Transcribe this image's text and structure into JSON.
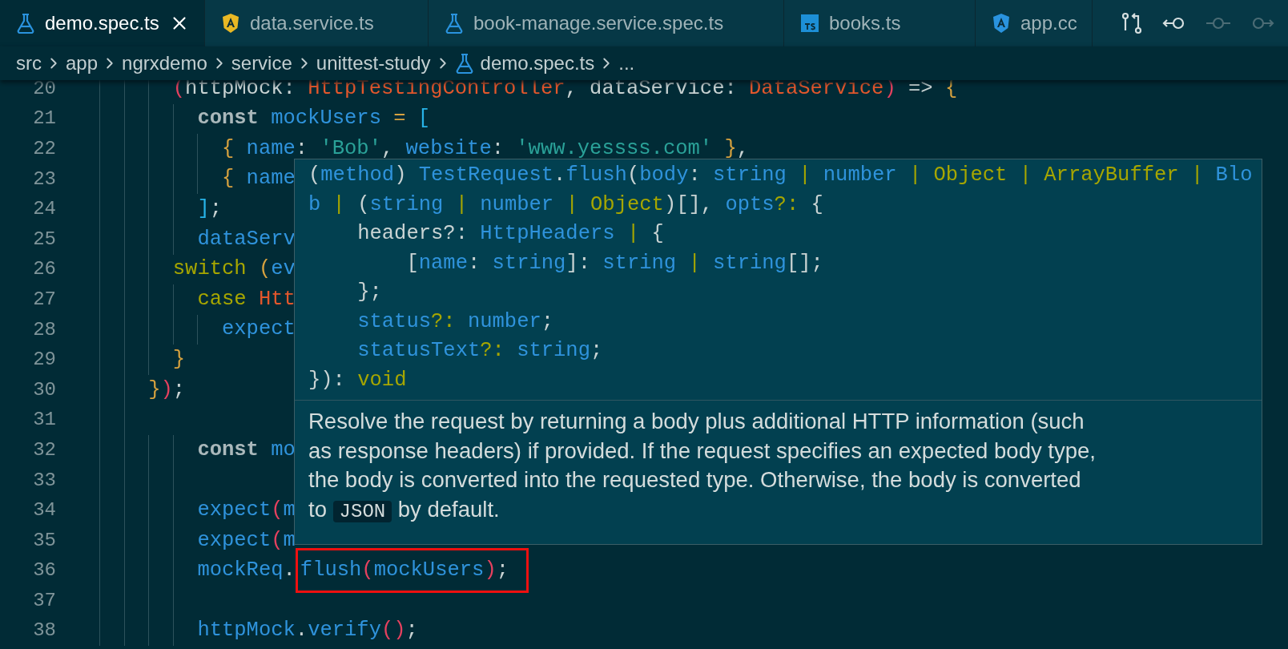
{
  "tabs": [
    {
      "label": "demo.spec.ts",
      "kind": "test",
      "selected": true
    },
    {
      "label": "data.service.ts",
      "kind": "service",
      "selected": false
    },
    {
      "label": "book-manage.service.spec.ts",
      "kind": "test",
      "selected": false
    },
    {
      "label": "books.ts",
      "kind": "typescript",
      "selected": false
    },
    {
      "label": "app.cc",
      "kind": "component",
      "selected": false
    }
  ],
  "toolbar": [
    {
      "kind": "compare",
      "disabled": false
    },
    {
      "kind": "back",
      "disabled": false
    },
    {
      "kind": "commit",
      "disabled": true
    },
    {
      "kind": "forward",
      "disabled": true
    }
  ],
  "breadcrumb": [
    {
      "label": "src",
      "kind": "folder"
    },
    {
      "label": "app",
      "kind": "folder"
    },
    {
      "label": "ngrxdemo",
      "kind": "folder"
    },
    {
      "label": "service",
      "kind": "folder"
    },
    {
      "label": "unittest-study",
      "kind": "folder"
    },
    {
      "label": "demo.spec.ts",
      "kind": "file"
    },
    {
      "label": "...",
      "kind": "folder"
    }
  ],
  "code": [
    {
      "number": "20",
      "tokens": [
        {
          "t": "      (",
          "kind": "pink"
        },
        {
          "t": "httpMock: ",
          "kind": "plain"
        },
        {
          "t": "HttpTestingController",
          "kind": "type"
        },
        {
          "t": ", dataService: ",
          "kind": "plain"
        },
        {
          "t": "DataService",
          "kind": "type"
        },
        {
          "t": ")",
          "kind": "pink"
        },
        {
          "t": " => ",
          "kind": "plain"
        },
        {
          "t": "{",
          "kind": "gold"
        }
      ]
    },
    {
      "number": "21",
      "tokens": [
        {
          "t": "        const",
          "kind": "kw"
        },
        {
          "t": " mockUsers ",
          "kind": "id"
        },
        {
          "t": "= ",
          "kind": "gold"
        },
        {
          "t": "[",
          "kind": "cyan"
        }
      ]
    },
    {
      "number": "22",
      "tokens": [
        {
          "t": "          { ",
          "kind": "gold"
        },
        {
          "t": "name",
          "kind": "id"
        },
        {
          "t": ": ",
          "kind": "plain"
        },
        {
          "t": "'Bob'",
          "kind": "str"
        },
        {
          "t": ", ",
          "kind": "plain"
        },
        {
          "t": "website",
          "kind": "id"
        },
        {
          "t": ": ",
          "kind": "plain"
        },
        {
          "t": "'www.yessss.com'",
          "kind": "str"
        },
        {
          "t": " }",
          "kind": "gold"
        },
        {
          "t": ",",
          "kind": "plain"
        }
      ]
    },
    {
      "number": "23",
      "tokens": [
        {
          "t": "          { ",
          "kind": "gold"
        },
        {
          "t": "name",
          "kind": "id"
        }
      ]
    },
    {
      "number": "24",
      "tokens": [
        {
          "t": "        ]",
          "kind": "cyan"
        },
        {
          "t": ";",
          "kind": "plain"
        }
      ]
    },
    {
      "number": "25",
      "tokens": [
        {
          "t": "        dataServ",
          "kind": "id"
        }
      ]
    },
    {
      "number": "26",
      "tokens": [
        {
          "t": "      switch",
          "kind": "ctl"
        },
        {
          "t": " (",
          "kind": "gold"
        },
        {
          "t": "ev",
          "kind": "id"
        }
      ]
    },
    {
      "number": "27",
      "tokens": [
        {
          "t": "        case",
          "kind": "ctl"
        },
        {
          "t": " Htt",
          "kind": "type"
        }
      ]
    },
    {
      "number": "28",
      "tokens": [
        {
          "t": "          expect",
          "kind": "id"
        }
      ]
    },
    {
      "number": "29",
      "tokens": [
        {
          "t": "      }",
          "kind": "gold"
        }
      ]
    },
    {
      "number": "30",
      "tokens": [
        {
          "t": "    }",
          "kind": "gold"
        },
        {
          "t": ")",
          "kind": "pink"
        },
        {
          "t": ";",
          "kind": "plain"
        }
      ]
    },
    {
      "number": "31"
    },
    {
      "number": "32",
      "tokens": [
        {
          "t": "        const",
          "kind": "kw"
        },
        {
          "t": " mo",
          "kind": "id"
        }
      ]
    },
    {
      "number": "33"
    },
    {
      "number": "34",
      "tokens": [
        {
          "t": "        expect",
          "kind": "id"
        },
        {
          "t": "(",
          "kind": "pink"
        },
        {
          "t": "m",
          "kind": "id"
        }
      ]
    },
    {
      "number": "35",
      "tokens": [
        {
          "t": "        expect",
          "kind": "id"
        },
        {
          "t": "(",
          "kind": "pink"
        },
        {
          "t": "m",
          "kind": "id"
        }
      ]
    },
    {
      "number": "36",
      "tokens": [
        {
          "t": "        mockReq",
          "kind": "id"
        },
        {
          "t": ".",
          "kind": "plain"
        }
      ],
      "framed_tokens": [
        {
          "t": "flush",
          "kind": "id"
        },
        {
          "t": "(",
          "kind": "pink"
        },
        {
          "t": "mockUsers",
          "kind": "id"
        },
        {
          "t": ")",
          "kind": "pink"
        },
        {
          "t": ";",
          "kind": "plain"
        }
      ]
    },
    {
      "number": "37"
    },
    {
      "number": "38",
      "tokens": [
        {
          "t": "        httpMock",
          "kind": "id"
        },
        {
          "t": ".",
          "kind": "plain"
        },
        {
          "t": "verify",
          "kind": "id"
        },
        {
          "t": "()",
          "kind": "pink"
        },
        {
          "t": ";",
          "kind": "plain"
        }
      ]
    }
  ],
  "hover": {
    "signature": [
      [
        {
          "t": "(",
          "kind": "plain"
        },
        {
          "t": "method",
          "kind": "blue"
        },
        {
          "t": ") ",
          "kind": "plain"
        },
        {
          "t": "TestRequest",
          "kind": "blue"
        },
        {
          "t": ".",
          "kind": "plain"
        },
        {
          "t": "flush",
          "kind": "blue"
        },
        {
          "t": "(",
          "kind": "plain"
        },
        {
          "t": "body",
          "kind": "blue"
        },
        {
          "t": ": ",
          "kind": "plain"
        },
        {
          "t": "string",
          "kind": "blue"
        },
        {
          "t": " | ",
          "kind": "olive"
        },
        {
          "t": "number",
          "kind": "blue"
        },
        {
          "t": " | ",
          "kind": "olive"
        },
        {
          "t": "Object",
          "kind": "olive"
        },
        {
          "t": " | ",
          "kind": "olive"
        },
        {
          "t": "ArrayBuffer",
          "kind": "olive"
        },
        {
          "t": " | ",
          "kind": "olive"
        },
        {
          "t": "Blo",
          "kind": "blue"
        }
      ],
      [
        {
          "t": "b",
          "kind": "blue"
        },
        {
          "t": " | ",
          "kind": "olive"
        },
        {
          "t": "(",
          "kind": "plain"
        },
        {
          "t": "string",
          "kind": "blue"
        },
        {
          "t": " | ",
          "kind": "olive"
        },
        {
          "t": "number",
          "kind": "blue"
        },
        {
          "t": " | ",
          "kind": "olive"
        },
        {
          "t": "Object",
          "kind": "olive"
        },
        {
          "t": ")[], ",
          "kind": "plain"
        },
        {
          "t": "opts",
          "kind": "blue"
        },
        {
          "t": "?:",
          "kind": "olive"
        },
        {
          "t": " {",
          "kind": "plain"
        }
      ],
      [
        {
          "t": "    headers?: ",
          "kind": "plain"
        },
        {
          "t": "HttpHeaders",
          "kind": "blue"
        },
        {
          "t": " | ",
          "kind": "olive"
        },
        {
          "t": "{",
          "kind": "plain"
        }
      ],
      [
        {
          "t": "        [",
          "kind": "plain"
        },
        {
          "t": "name",
          "kind": "blue"
        },
        {
          "t": ": ",
          "kind": "plain"
        },
        {
          "t": "string",
          "kind": "blue"
        },
        {
          "t": "]: ",
          "kind": "plain"
        },
        {
          "t": "string",
          "kind": "blue"
        },
        {
          "t": " | ",
          "kind": "olive"
        },
        {
          "t": "string",
          "kind": "blue"
        },
        {
          "t": "[];",
          "kind": "plain"
        }
      ],
      [
        {
          "t": "    };",
          "kind": "plain"
        }
      ],
      [
        {
          "t": "    status",
          "kind": "blue"
        },
        {
          "t": "?:",
          "kind": "olive"
        },
        {
          "t": " number",
          "kind": "blue"
        },
        {
          "t": ";",
          "kind": "plain"
        }
      ],
      [
        {
          "t": "    statusText",
          "kind": "blue"
        },
        {
          "t": "?:",
          "kind": "olive"
        },
        {
          "t": " string",
          "kind": "blue"
        },
        {
          "t": ";",
          "kind": "plain"
        }
      ],
      [
        {
          "t": "}): ",
          "kind": "plain"
        },
        {
          "t": "void",
          "kind": "olive"
        }
      ]
    ],
    "description": [
      {
        "t": "Resolve the request by returning a body plus additional HTTP information (such as response headers) if provided. If the request specifies an expected body type, the body is converted into the requested type. Otherwise, the body is converted to ",
        "kind": "text"
      },
      {
        "t": "JSON",
        "kind": "code"
      },
      {
        "t": " by default.",
        "kind": "text"
      }
    ]
  }
}
